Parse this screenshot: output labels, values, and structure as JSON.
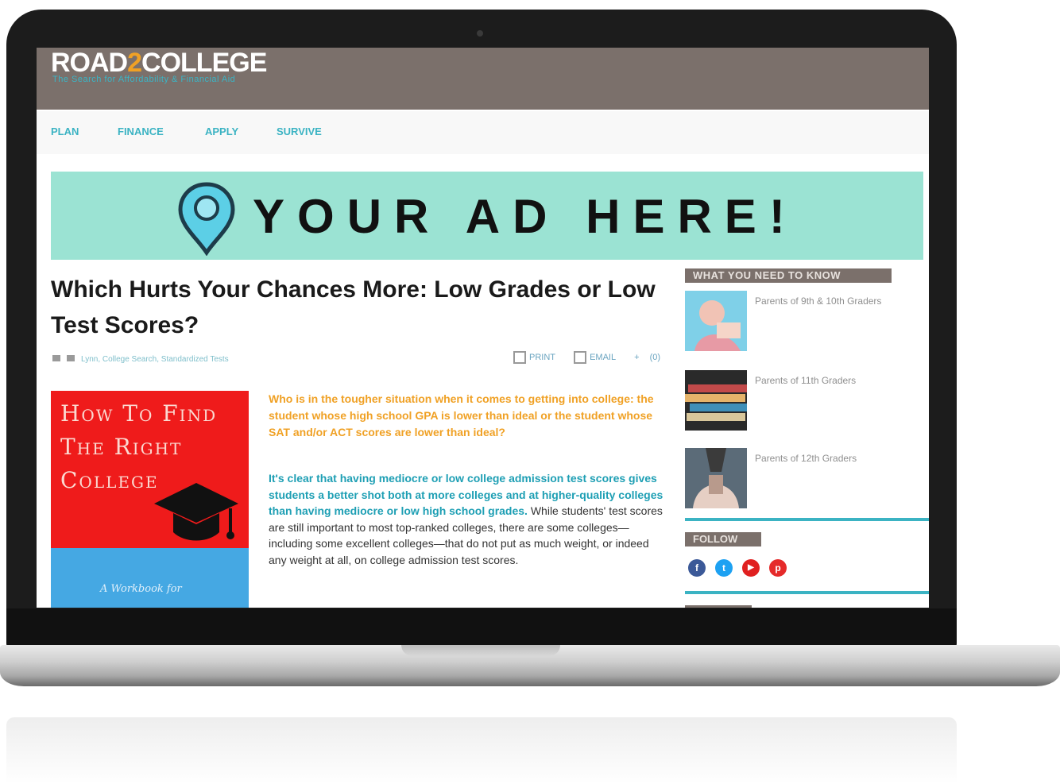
{
  "site": {
    "logo_prefix": "ROAD",
    "logo_number": "2",
    "logo_suffix": "COLLEGE",
    "tagline": "The Search for Affordability & Financial Aid"
  },
  "nav": {
    "items": [
      "PLAN",
      "FINANCE",
      "APPLY",
      "SURVIVE"
    ]
  },
  "ad": {
    "text": "YOUR AD HERE!",
    "pin_color": "#5ccfe6",
    "background": "#9be3d3"
  },
  "article": {
    "title": "Which Hurts Your Chances More: Low Grades or Low Test Scores?",
    "byline": "Lynn, College Search, Standardized Tests",
    "tools": [
      "PRINT",
      "EMAIL",
      "+",
      "(0)"
    ],
    "lead": "Who is in the tougher situation when it comes to getting into college: the student whose high school GPA is lower than ideal or the student whose SAT and/or ACT scores are lower than ideal?",
    "body_highlight": "It's clear that having mediocre or low college admission test scores gives students a better shot both at more colleges and at higher-quality colleges than having mediocre or low high school grades.",
    "body_rest": " While students' test scores are still important to most top-ranked colleges, there are some colleges—including some excellent colleges—that do not put as much weight, or indeed any weight at all, on college admission test scores."
  },
  "book": {
    "title": "How To Find The Right College",
    "subtitle": "A Workbook for",
    "red": "#ef1b1b",
    "blue": "#45a8e3"
  },
  "sidebar": {
    "heading": "WHAT YOU NEED TO KNOW",
    "items": [
      {
        "label": "Parents of 9th & 10th Graders"
      },
      {
        "label": "Parents of 11th Graders"
      },
      {
        "label": "Parents of 12th Graders"
      }
    ],
    "follow_heading": "FOLLOW",
    "social": [
      {
        "icon": "facebook-icon",
        "glyph": "f",
        "color": "#3b5998"
      },
      {
        "icon": "twitter-icon",
        "glyph": "t",
        "color": "#1da1f2"
      },
      {
        "icon": "youtube-icon",
        "glyph": "▶",
        "color": "#e02020"
      },
      {
        "icon": "pinterest-icon",
        "glyph": "p",
        "color": "#e52a2a"
      }
    ]
  }
}
